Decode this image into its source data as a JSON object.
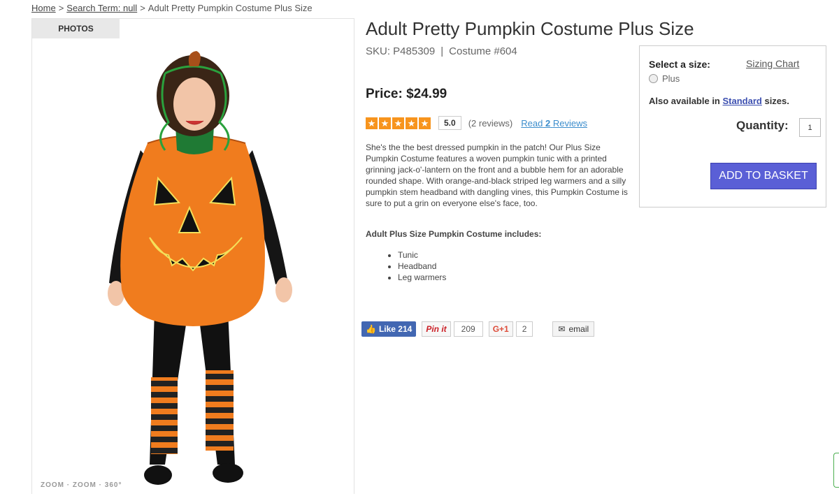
{
  "breadcrumb": {
    "home": "Home",
    "search": "Search Term: null",
    "current": "Adult Pretty Pumpkin Costume Plus Size",
    "separator": ">"
  },
  "gallery": {
    "tab_label": "PHOTOS",
    "caption": "ZOOM · ZOOM · 360°"
  },
  "product": {
    "title": "Adult Pretty Pumpkin Costume Plus Size",
    "sku": "SKU: P485309",
    "costume_no": "Costume #604",
    "price": "Price: $24.99",
    "rating": {
      "stars": 5,
      "score": "5.0",
      "review_count": "(2 reviews)",
      "read_prefix": "Read",
      "read_number": "2",
      "read_suffix": "Reviews"
    },
    "description": "She's the the best dressed pumpkin in the patch! Our Plus Size Pumpkin Costume features a woven pumpkin tunic with a printed grinning jack-o'-lantern on the front and a bubble hem for an adorable rounded shape. With orange-and-black striped leg warmers and a silly pumpkin stem headband with dangling vines, this Pumpkin Costume is sure to put a grin on everyone else's face, too.",
    "includes_title": "Adult Plus Size Pumpkin Costume includes:",
    "includes": [
      "Tunic",
      "Headband",
      "Leg warmers"
    ]
  },
  "social": {
    "facebook_label": "Like 214",
    "pinterest_label": "Pin it",
    "pinterest_count": "209",
    "gplus_label": "G+1",
    "gplus_count": "2",
    "email_label": "email"
  },
  "buy_box": {
    "size_label": "Select a size:",
    "sizing_chart": "Sizing Chart",
    "size_options": [
      "Plus"
    ],
    "also_prefix": "Also available in",
    "also_link": "Standard",
    "also_suffix": "sizes.",
    "quantity_label": "Quantity:",
    "quantity_value": "1",
    "add_button": "ADD TO BASKET"
  },
  "colors": {
    "accent_button": "#5a5fd6",
    "star": "#f7941d",
    "link": "#3c8dcc",
    "facebook": "#4267b2",
    "pinterest": "#cb2027"
  }
}
